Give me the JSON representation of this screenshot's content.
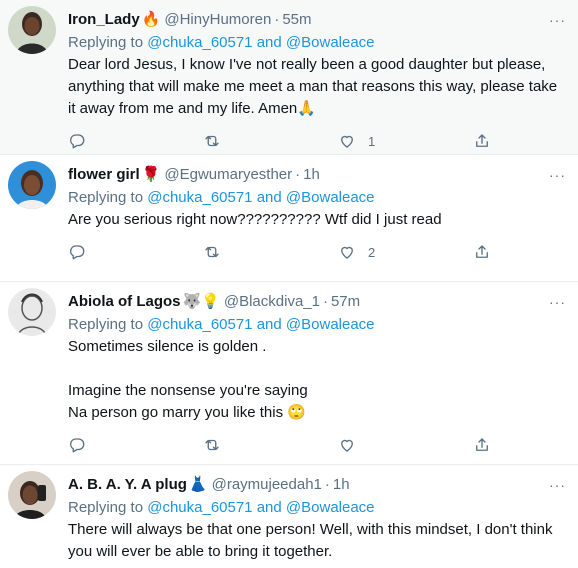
{
  "tweets": [
    {
      "name": "Iron_Lady",
      "badge": "🔥",
      "handle": "@HinyHumoren",
      "time": "55m",
      "reply_prefix": "Replying to ",
      "mention1": "@chuka_60571",
      "and": " and ",
      "mention2": "@Bowaleace",
      "text": "Dear lord Jesus, I know I've not really been a good daughter but please, anything that will make me meet a man that reasons this way, please take it away from me and my life. Amen🙏",
      "likes": "1",
      "avatar": "woman-smiling-avatar"
    },
    {
      "name": "flower girl",
      "badge": "🌹",
      "handle": "@Egwumaryesther",
      "time": "1h",
      "reply_prefix": "Replying to ",
      "mention1": "@chuka_60571",
      "and": " and ",
      "mention2": "@Bowaleace",
      "text": "Are you serious right now?????????? Wtf did I just read",
      "likes": "2",
      "avatar": "woman-blue-background-avatar"
    },
    {
      "name": "Abiola of Lagos",
      "badge": "🐺💡",
      "handle": "@Blackdiva_1",
      "time": "57m",
      "reply_prefix": "Replying to ",
      "mention1": "@chuka_60571",
      "and": " and ",
      "mention2": "@Bowaleace",
      "text": "Sometimes silence is golden .\n\nImagine the nonsense you're saying\nNa person go marry you like this 🙄",
      "likes": "",
      "avatar": "sketch-avatar"
    },
    {
      "name": "A. B. A. Y. A plug",
      "badge": "👗",
      "handle": "@raymujeedah1",
      "time": "1h",
      "reply_prefix": "Replying to ",
      "mention1": "@chuka_60571",
      "and": " and ",
      "mention2": "@Bowaleace",
      "text": "There will always be that one person! Well, with this mindset, I don't think you will ever be able to bring it together.",
      "likes": "",
      "avatar": "woman-selfie-avatar"
    }
  ],
  "more_label": "···",
  "dot": "·",
  "colors": {
    "link": "#1b95e0",
    "muted": "#5b7083",
    "text": "#0f1419",
    "highlight_bg": "#f7f9f9"
  }
}
